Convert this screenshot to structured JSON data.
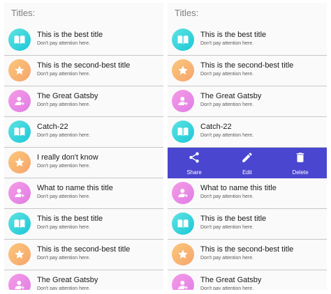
{
  "header": {
    "title": "Titles:"
  },
  "subtitle": "Don't pay attention here.",
  "left_list": [
    {
      "title": "This is the best title",
      "icon": "book-icon"
    },
    {
      "title": "This is the second-best title",
      "icon": "star-icon"
    },
    {
      "title": "The Great Gatsby",
      "icon": "user-icon"
    },
    {
      "title": "Catch-22",
      "icon": "book-icon"
    },
    {
      "title": "I really don't know",
      "icon": "star-icon"
    },
    {
      "title": "What to name this title",
      "icon": "user-icon"
    },
    {
      "title": "This is the best title",
      "icon": "book-icon"
    },
    {
      "title": "This is the second-best title",
      "icon": "star-icon"
    },
    {
      "title": "The Great Gatsby",
      "icon": "user-icon"
    }
  ],
  "right_list": [
    {
      "title": "This is the best title",
      "icon": "book-icon"
    },
    {
      "title": "This is the second-best title",
      "icon": "star-icon"
    },
    {
      "title": "The Great Gatsby",
      "icon": "user-icon"
    },
    {
      "title": "Catch-22",
      "icon": "book-icon"
    },
    {
      "title": "What to name this title",
      "icon": "user-icon"
    },
    {
      "title": "This is the best title",
      "icon": "book-icon"
    },
    {
      "title": "This is the second-best title",
      "icon": "star-icon"
    },
    {
      "title": "The Great Gatsby",
      "icon": "user-icon"
    }
  ],
  "swipe_actions": [
    {
      "label": "Share",
      "icon": "share-icon"
    },
    {
      "label": "Edit",
      "icon": "edit-icon"
    },
    {
      "label": "Delete",
      "icon": "delete-icon"
    }
  ],
  "colors": {
    "action_bar": "#4a46cf",
    "book_gradient": [
      "#5fe3e1",
      "#19c8d8"
    ],
    "star_gradient": [
      "#fbc77a",
      "#f6a46c"
    ],
    "user_gradient": [
      "#f59be7",
      "#e07de4"
    ]
  }
}
